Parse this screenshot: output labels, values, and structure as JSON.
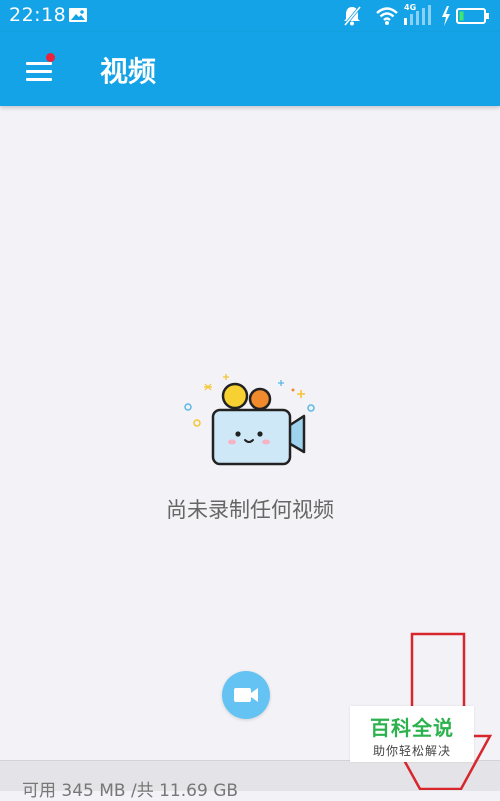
{
  "status_bar": {
    "time": "22:18",
    "network_label": "4G",
    "icons": [
      "image-icon",
      "bell-muted-icon",
      "wifi-icon",
      "signal-icon",
      "charging-icon",
      "battery-icon"
    ]
  },
  "app_bar": {
    "title": "视频",
    "menu_icon": "hamburger-menu-icon",
    "has_notification_dot": true,
    "notification_dot_color": "#e8233a",
    "background_color": "#14a3e6"
  },
  "empty_state": {
    "illustration": "video-camera-illustration",
    "message": "尚未录制任何视频"
  },
  "record_button": {
    "icon": "video-camera-icon",
    "color": "#64c3f3"
  },
  "storage": {
    "text": "可用 345 MB /共 11.69 GB"
  },
  "watermark": {
    "title": "百科全说",
    "subtitle": "助你轻松解决",
    "title_color": "#2bb24c"
  },
  "annotation": {
    "icon": "down-arrow-outline-icon",
    "color": "#d7262c"
  }
}
